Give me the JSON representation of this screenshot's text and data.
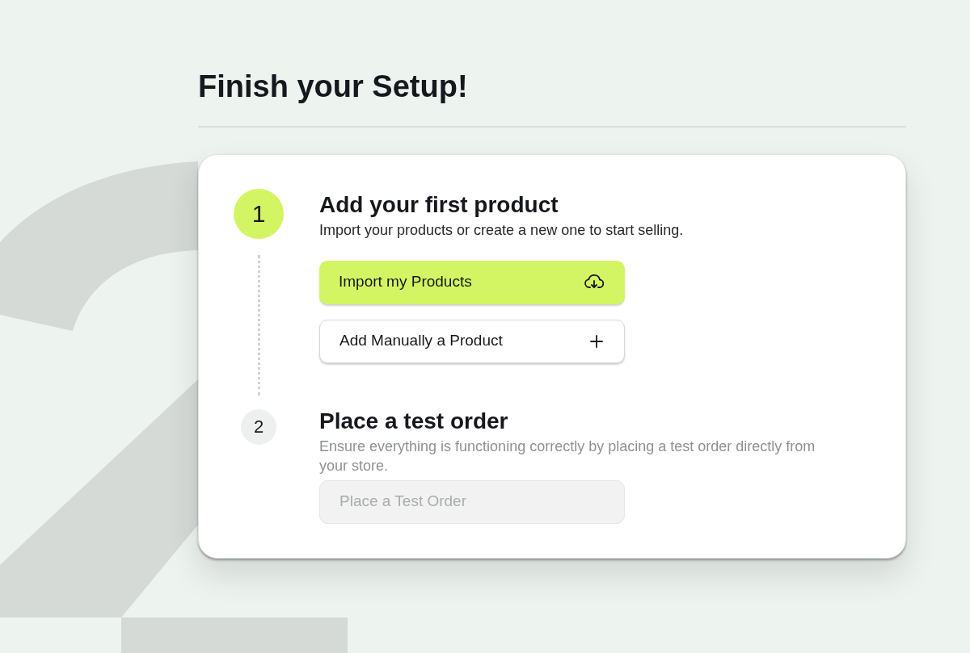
{
  "title": "Finish your Setup!",
  "steps": [
    {
      "number": "1",
      "active": true,
      "title": "Add your first product",
      "description": "Import your products or create a new one to start selling.",
      "buttons": [
        {
          "label": "Import my Products",
          "kind": "import",
          "disabled": false
        },
        {
          "label": "Add Manually a Product",
          "kind": "add",
          "disabled": false
        }
      ]
    },
    {
      "number": "2",
      "active": false,
      "title": "Place a test order",
      "description": "Ensure everything is functioning correctly by placing a test order directly from your store.",
      "buttons": [
        {
          "label": "Place a Test Order",
          "kind": "order",
          "disabled": true
        }
      ]
    }
  ]
}
